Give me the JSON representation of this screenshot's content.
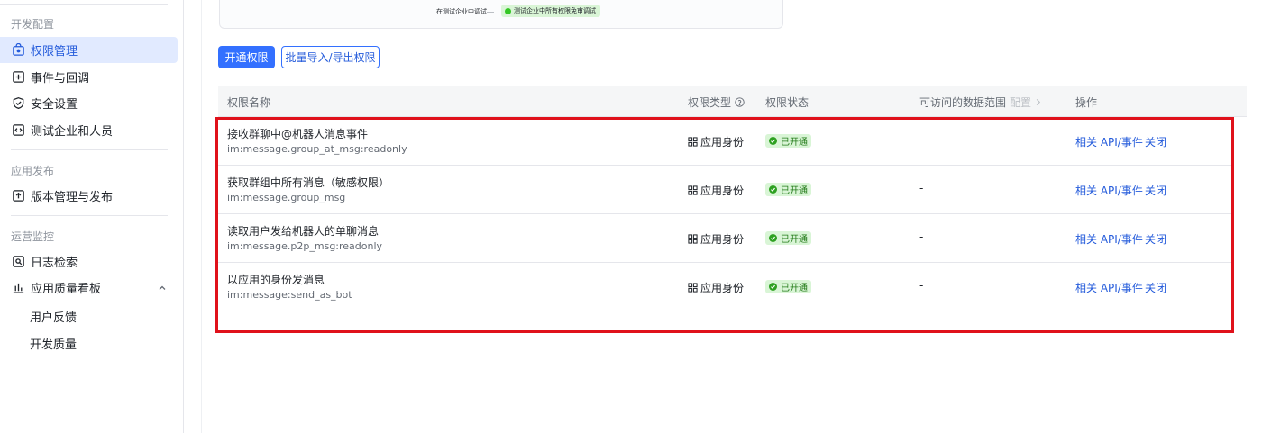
{
  "sidebar": {
    "groups": {
      "dev": "开发配置",
      "publish": "应用发布",
      "ops": "运营监控"
    },
    "items": [
      {
        "label": "权限管理",
        "icon": "permission-icon"
      },
      {
        "label": "事件与回调",
        "icon": "event-icon"
      },
      {
        "label": "安全设置",
        "icon": "shield-icon"
      },
      {
        "label": "测试企业和人员",
        "icon": "code-icon"
      },
      {
        "label": "版本管理与发布",
        "icon": "upload-icon"
      },
      {
        "label": "日志检索",
        "icon": "log-search-icon"
      },
      {
        "label": "应用质量看板",
        "icon": "bar-chart-icon"
      }
    ],
    "sub_items": [
      "用户反馈",
      "开发质量"
    ]
  },
  "preview": {
    "left_text": "在测试企业中调试",
    "tag_text": "测试企业中所有权限免审调试"
  },
  "toolbar": {
    "primary_label": "开通权限",
    "secondary_label": "批量导入/导出权限"
  },
  "table": {
    "headers": {
      "name": "权限名称",
      "type": "权限类型",
      "status": "权限状态",
      "scope": "可访问的数据范围",
      "scope_link": "配置",
      "actions": "操作"
    },
    "rows": [
      {
        "name": "接收群聊中@机器人消息事件",
        "key": "im:message.group_at_msg:readonly",
        "type": "应用身份",
        "status": "已开通",
        "scope": "-",
        "action_api": "相关 API/事件",
        "action_close": "关闭"
      },
      {
        "name": "获取群组中所有消息（敏感权限）",
        "key": "im:message.group_msg",
        "type": "应用身份",
        "status": "已开通",
        "scope": "-",
        "action_api": "相关 API/事件",
        "action_close": "关闭"
      },
      {
        "name": "读取用户发给机器人的单聊消息",
        "key": "im:message.p2p_msg:readonly",
        "type": "应用身份",
        "status": "已开通",
        "scope": "-",
        "action_api": "相关 API/事件",
        "action_close": "关闭"
      },
      {
        "name": "以应用的身份发消息",
        "key": "im:message:send_as_bot",
        "type": "应用身份",
        "status": "已开通",
        "scope": "-",
        "action_api": "相关 API/事件",
        "action_close": "关闭"
      }
    ]
  },
  "colors": {
    "accent": "#3370ff",
    "link": "#245bdb",
    "active_bg": "#e1eaff",
    "success_bg": "#d9f5d6",
    "success_text": "#237b19",
    "highlight_border": "#e0111b"
  }
}
